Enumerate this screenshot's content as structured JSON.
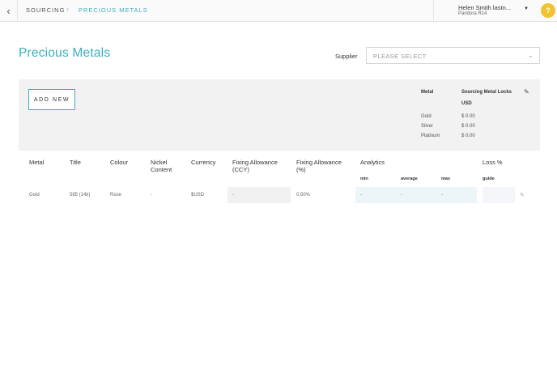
{
  "topbar": {
    "back_glyph": "‹",
    "crumb_sourcing": "SOURCING",
    "crumb_sep": "›",
    "crumb_current": "PRECIOUS METALS",
    "user_name": "Helen Smith lastn...",
    "user_org": "Pandora R14",
    "user_caret": "▼",
    "help": "?"
  },
  "page": {
    "title": "Precious Metals",
    "supplier_label": "Supplier",
    "supplier_placeholder": "PLEASE SELECT",
    "chevron_glyph": "⌄"
  },
  "panel": {
    "add_new": "ADD NEW",
    "metal_header": "Metal",
    "locks_header": "Sourcing Metal Locks",
    "locks_currency": "USD",
    "edit_glyph": "✎",
    "locks": [
      {
        "metal": "Gold",
        "value": "$ 0.00"
      },
      {
        "metal": "Silver",
        "value": "$ 0.00"
      },
      {
        "metal": "Platinum",
        "value": "$ 0.00"
      }
    ]
  },
  "table": {
    "headers": {
      "metal": "Metal",
      "title": "Title",
      "colour": "Colour",
      "nickel": "Nickel Content",
      "currency": "Currency",
      "fixing_ccy": "Fixing Allowance (CCY)",
      "fixing_pct": "Fixing Allowance (%)",
      "analytics": "Analytics",
      "loss": "Loss %"
    },
    "subheaders": {
      "min": "min",
      "average": "average",
      "max": "max",
      "guide": "guide"
    },
    "rows": [
      {
        "metal": "Gold",
        "title": "585 (14k)",
        "colour": "Rose",
        "nickel": "-",
        "currency": "$USD",
        "fixing_ccy": "-",
        "fixing_pct": "0.50%",
        "min": "-",
        "average": "-",
        "max": "-",
        "edit_glyph": "✎"
      }
    ]
  },
  "colors": {
    "accent": "#3ab0c0",
    "help_badge": "#f1c232",
    "panel_bg": "#f2f2f2"
  }
}
